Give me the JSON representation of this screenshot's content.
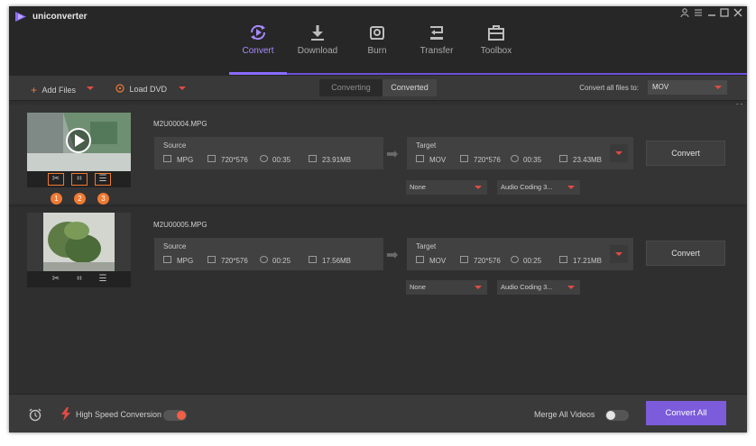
{
  "app": {
    "name": "uniconverter"
  },
  "nav": [
    {
      "label": "Convert",
      "icon": "convert-icon"
    },
    {
      "label": "Download",
      "icon": "download-icon"
    },
    {
      "label": "Burn",
      "icon": "burn-icon"
    },
    {
      "label": "Transfer",
      "icon": "transfer-icon"
    },
    {
      "label": "Toolbox",
      "icon": "toolbox-icon"
    }
  ],
  "toolbar": {
    "add_files": "Add Files",
    "load_dvd": "Load DVD",
    "tab_converting": "Converting",
    "tab_converted": "Converted",
    "convert_all_label": "Convert all files to:",
    "convert_all_value": "MOV"
  },
  "files": [
    {
      "name": "M2U00004.MPG",
      "source": {
        "label": "Source",
        "format": "MPG",
        "resolution": "720*576",
        "duration": "00:35",
        "size": "23.91MB"
      },
      "target": {
        "label": "Target",
        "format": "MOV",
        "resolution": "720*576",
        "duration": "00:35",
        "size": "23.43MB"
      },
      "subtitle": "None",
      "audio": "Audio Coding 3...",
      "convert_label": "Convert",
      "badges": [
        "1",
        "2",
        "3"
      ]
    },
    {
      "name": "M2U00005.MPG",
      "source": {
        "label": "Source",
        "format": "MPG",
        "resolution": "720*576",
        "duration": "00:25",
        "size": "17.56MB"
      },
      "target": {
        "label": "Target",
        "format": "MOV",
        "resolution": "720*576",
        "duration": "00:25",
        "size": "17.21MB"
      },
      "subtitle": "None",
      "audio": "Audio Coding 3...",
      "convert_label": "Convert"
    }
  ],
  "bottom": {
    "high_speed_label": "High Speed Conversion",
    "high_speed_on": true,
    "merge_label": "Merge All Videos",
    "merge_on": false,
    "convert_all_button": "Convert All"
  },
  "colors": {
    "accent": "#7c5cdb",
    "orange": "#f07a32",
    "red": "#e24a45"
  }
}
